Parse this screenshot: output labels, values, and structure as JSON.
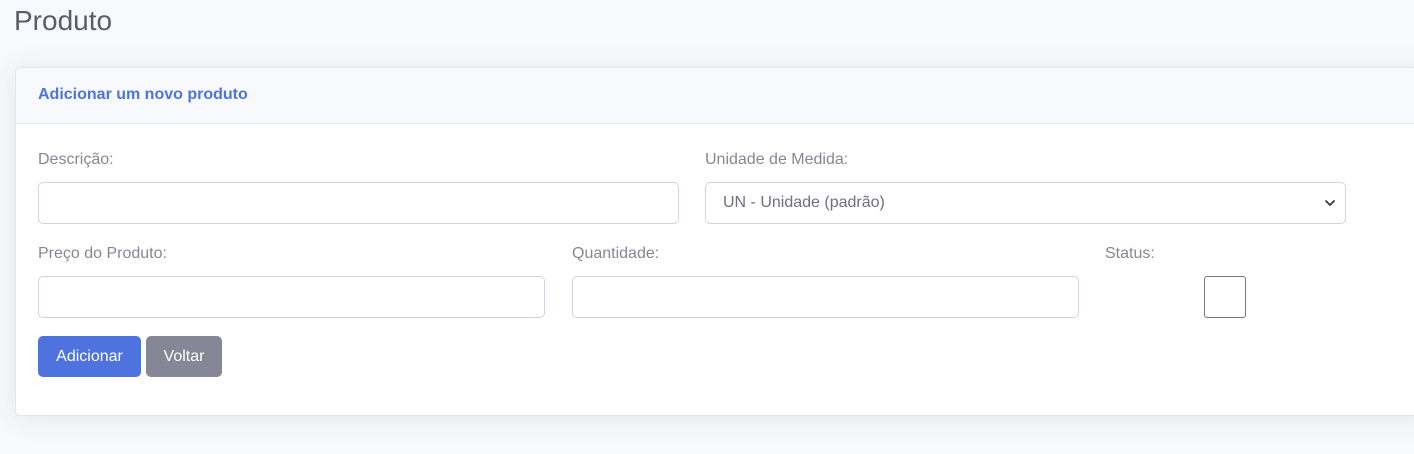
{
  "page": {
    "title": "Produto"
  },
  "card": {
    "header": "Adicionar um novo produto"
  },
  "form": {
    "descricao": {
      "label": "Descrição:",
      "value": ""
    },
    "unidade": {
      "label": "Unidade de Medida:",
      "selected": "UN - Unidade (padrão)"
    },
    "preco": {
      "label": "Preço do Produto:",
      "value": ""
    },
    "quantidade": {
      "label": "Quantidade:",
      "value": ""
    },
    "status": {
      "label": "Status:",
      "checked": false
    }
  },
  "buttons": {
    "add": "Adicionar",
    "back": "Voltar"
  },
  "colors": {
    "primary": "#4e73df",
    "secondary": "#858796",
    "background": "#f8f9fc"
  }
}
